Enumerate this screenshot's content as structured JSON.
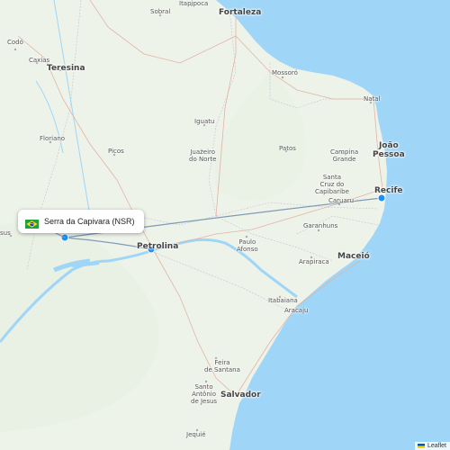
{
  "map": {
    "origin": {
      "name": "Serra da Capivara (NSR)",
      "country_flag": "brazil-flag-icon"
    },
    "route_color": "#7f9bb3",
    "airport_dot_color": "#1e8ff5",
    "land_color": "#eef3ea",
    "water_color": "#9fd6f8",
    "attribution": "Leaflet",
    "cities": {
      "sobral": "Sobral",
      "itapipoca": "Itapipoca",
      "fortaleza": "Fortaleza",
      "codo": "Codó",
      "caxias": "Caxias",
      "teresina": "Teresina",
      "mossoro": "Mossoró",
      "natal": "Natal",
      "iguatu": "Iguatu",
      "floriano": "Floriano",
      "picos": "Picos",
      "juazeiro_do_norte": "Juazeiro\ndo Norte",
      "patos": "Patos",
      "campina_grande": "Campina\nGrande",
      "joao_pessoa": "João\nPessoa",
      "santa_cruz": "Santa\nCruz do\nCapibaribe",
      "recife": "Recife",
      "caruaru": "Caruaru",
      "garanhuns": "Garanhuns",
      "sus": "sus",
      "petrolina": "Petrolina",
      "paulo_afonso": "Paulo\nAfonso",
      "arapiraca": "Arapiraca",
      "maceio": "Maceió",
      "itabaiana": "Itabaiana",
      "aracaju": "Aracaju",
      "feira_de_santana": "Feira\nde Santana",
      "santo_antonio": "Santo\nAntônio\nde Jesus",
      "salvador": "Salvador",
      "jequie": "Jequié"
    }
  }
}
